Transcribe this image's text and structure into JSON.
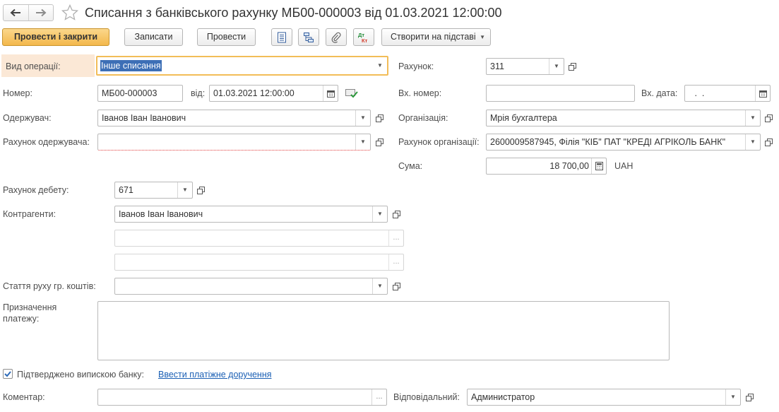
{
  "title": "Списання з банківського рахунку МБ00-000003 від 01.03.2021 12:00:00",
  "toolbar": {
    "post_close": "Провести і закрити",
    "save": "Записати",
    "post": "Провести",
    "create_based": "Створити на підставі"
  },
  "form": {
    "operation_type": {
      "label": "Вид операції:",
      "value": "Інше списання"
    },
    "account": {
      "label": "Рахунок:",
      "value": "311"
    },
    "number": {
      "label": "Номер:",
      "value": "МБ00-000003"
    },
    "date": {
      "label": "від:",
      "value": "01.03.2021 12:00:00"
    },
    "incoming_number": {
      "label": "Вх. номер:",
      "value": ""
    },
    "incoming_date": {
      "label": "Вх. дата:",
      "value": " .  ."
    },
    "recipient": {
      "label": "Одержувач:",
      "value": "Іванов Іван Іванович"
    },
    "organization": {
      "label": "Організація:",
      "value": "Мрія бухгалтера"
    },
    "recipient_account": {
      "label": "Рахунок одержувача:",
      "value": ""
    },
    "org_account": {
      "label": "Рахунок організації:",
      "value": "2600009587945, Філія \"КІБ\" ПАТ \"КРЕДІ АГРІКОЛЬ БАНК\""
    },
    "amount": {
      "label": "Сума:",
      "value": "18 700,00",
      "currency": "UAH"
    },
    "debit_account": {
      "label": "Рахунок дебету:",
      "value": "671"
    },
    "counterparties": {
      "label": "Контрагенти:",
      "value": "Іванов Іван Іванович"
    },
    "cash_flow_item": {
      "label": "Стаття руху гр. коштів:",
      "value": ""
    },
    "payment_purpose": {
      "label_line1": "Призначення",
      "label_line2": "платежу:",
      "value": ""
    },
    "bank_confirmed": {
      "label": "Підтверджено випискою банку:",
      "checked": true
    },
    "enter_payment_order": "Ввести платіжне доручення",
    "comment": {
      "label": "Коментар:",
      "value": ""
    },
    "responsible": {
      "label": "Відповідальний:",
      "value": "Администратор"
    }
  },
  "colors": {
    "accent": "#f3b84c",
    "focus_border": "#f2bd58",
    "highlight_label_bg": "#fbe8d6",
    "selection": "#3d6fb6",
    "link": "#1a5fb4"
  }
}
